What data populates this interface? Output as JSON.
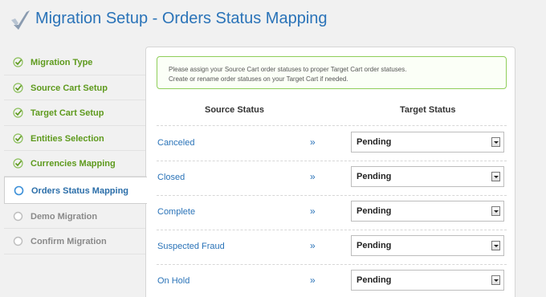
{
  "header": {
    "title": "Migration Setup - Orders Status Mapping"
  },
  "sidebar": {
    "steps": [
      {
        "label": "Migration Type",
        "state": "done"
      },
      {
        "label": "Source Cart Setup",
        "state": "done"
      },
      {
        "label": "Target Cart Setup",
        "state": "done"
      },
      {
        "label": "Entities Selection",
        "state": "done"
      },
      {
        "label": "Currencies Mapping",
        "state": "done"
      },
      {
        "label": "Orders Status Mapping",
        "state": "current"
      },
      {
        "label": "Demo Migration",
        "state": "pending"
      },
      {
        "label": "Confirm Migration",
        "state": "pending"
      }
    ]
  },
  "notice": {
    "line1": "Please assign your Source Cart order statuses to proper Target Cart order statuses.",
    "line2": "Create or rename order statuses on your Target Cart if needed."
  },
  "table": {
    "source_header": "Source Status",
    "target_header": "Target Status",
    "arrow": "»",
    "rows": [
      {
        "source": "Canceled",
        "target": "Pending"
      },
      {
        "source": "Closed",
        "target": "Pending"
      },
      {
        "source": "Complete",
        "target": "Pending"
      },
      {
        "source": "Suspected Fraud",
        "target": "Pending"
      },
      {
        "source": "On Hold",
        "target": "Pending"
      }
    ]
  },
  "colors": {
    "done": "#5e9a1d",
    "current": "#2b6ea9",
    "pending": "#8a8a8a",
    "accent": "#2a73b8"
  }
}
